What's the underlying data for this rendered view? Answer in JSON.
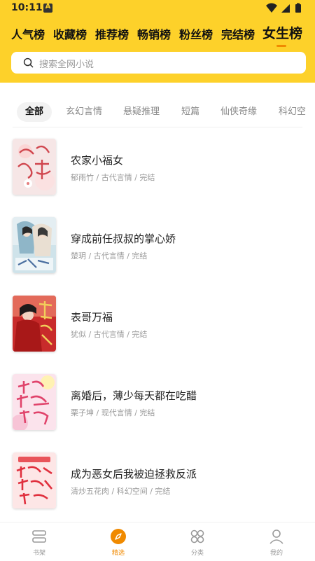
{
  "status_bar": {
    "time": "10:11",
    "notification_letter": "A"
  },
  "ranking_tabs": [
    {
      "label": "人气榜"
    },
    {
      "label": "收藏榜"
    },
    {
      "label": "推荐榜"
    },
    {
      "label": "畅销榜"
    },
    {
      "label": "粉丝榜"
    },
    {
      "label": "完结榜"
    },
    {
      "label": "女生榜",
      "active": true
    }
  ],
  "search": {
    "placeholder": "搜索全网小说",
    "icon": "search-icon"
  },
  "filters": [
    {
      "label": "全部",
      "active": true
    },
    {
      "label": "玄幻言情"
    },
    {
      "label": "悬疑推理"
    },
    {
      "label": "短篇"
    },
    {
      "label": "仙侠奇缘"
    },
    {
      "label": "科幻空"
    }
  ],
  "books": [
    {
      "title": "农家小福女",
      "meta": "郁雨竹 / 古代言情 / 完结"
    },
    {
      "title": "穿成前任叔叔的掌心娇",
      "meta": "楚玥 / 古代言情 / 完结"
    },
    {
      "title": "表哥万福",
      "meta": "犹似 / 古代言情 / 完结"
    },
    {
      "title": "离婚后，薄少每天都在吃醋",
      "meta": "栗子坤 / 现代言情 / 完结"
    },
    {
      "title": "成为恶女后我被迫拯救反派",
      "meta": "清炒五花肉 / 科幻空间 / 完结"
    }
  ],
  "bottom_nav": [
    {
      "label": "书架",
      "icon": "bookshelf-icon"
    },
    {
      "label": "精选",
      "icon": "compass-icon",
      "active": true
    },
    {
      "label": "分类",
      "icon": "category-icon"
    },
    {
      "label": "我的",
      "icon": "profile-icon"
    }
  ],
  "colors": {
    "accent": "#fdd12a",
    "active_orange": "#f08a00"
  }
}
